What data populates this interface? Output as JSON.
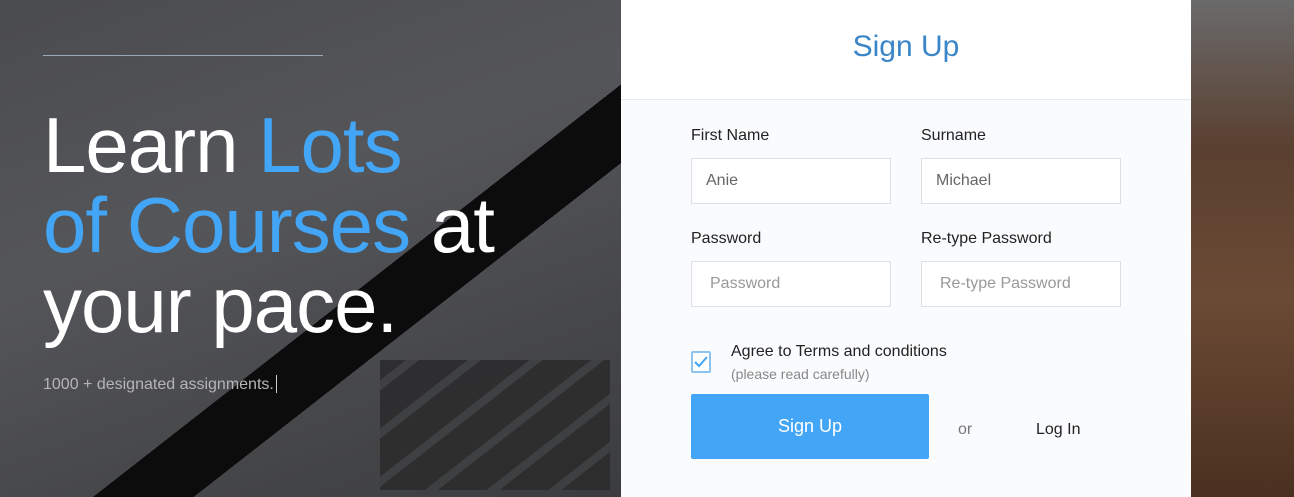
{
  "hero": {
    "headline": {
      "w1": "Learn ",
      "w2": "Lots",
      "w3": "of Courses",
      "w4": " at",
      "w5": "your pace."
    },
    "tagline": "1000 + designated assignments."
  },
  "form": {
    "title": "Sign Up",
    "first_name": {
      "label": "First Name",
      "value": "Anie"
    },
    "surname": {
      "label": "Surname",
      "value": "Michael"
    },
    "password": {
      "label": "Password",
      "placeholder": "Password"
    },
    "retype": {
      "label": "Re-type Password",
      "placeholder": "Re-type Password"
    },
    "terms": {
      "label": "Agree to Terms and conditions",
      "note": "(please read carefully)",
      "checked": true
    },
    "submit_label": "Sign Up",
    "or_label": "or",
    "login_label": "Log In"
  },
  "colors": {
    "accent": "#42a5f5",
    "title": "#3a86c8"
  }
}
